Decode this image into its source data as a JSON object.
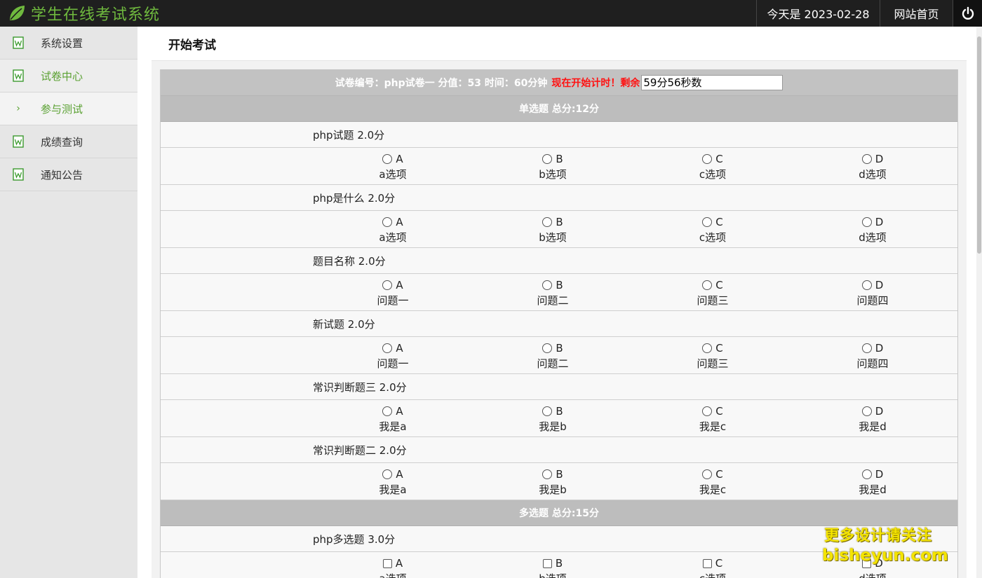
{
  "header": {
    "title": "学生在线考试系统",
    "date_text": "今天是 2023-02-28",
    "home_link": "网站首页",
    "brand_color": "#6fb93e"
  },
  "sidebar": {
    "items": [
      {
        "label": "系统设置"
      },
      {
        "label": "试卷中心"
      },
      {
        "label": "参与测试"
      },
      {
        "label": "成绩查询"
      },
      {
        "label": "通知公告"
      }
    ]
  },
  "main": {
    "page_title": "开始考试",
    "exam_info": {
      "prefix": "试卷编号：php试卷一 分值：53 时间：60分钟",
      "notice": "现在开始计时！剩余",
      "timer_value": "59分56秒数"
    },
    "sections": [
      {
        "header": "单选题 总分:12分",
        "input_type": "radio",
        "questions": [
          {
            "title": "php试题 2.0分",
            "options": [
              {
                "letter": "A",
                "text": "a选项"
              },
              {
                "letter": "B",
                "text": "b选项"
              },
              {
                "letter": "C",
                "text": "c选项"
              },
              {
                "letter": "D",
                "text": "d选项"
              }
            ]
          },
          {
            "title": "php是什么 2.0分",
            "options": [
              {
                "letter": "A",
                "text": "a选项"
              },
              {
                "letter": "B",
                "text": "b选项"
              },
              {
                "letter": "C",
                "text": "c选项"
              },
              {
                "letter": "D",
                "text": "d选项"
              }
            ]
          },
          {
            "title": "题目名称 2.0分",
            "options": [
              {
                "letter": "A",
                "text": "问题一"
              },
              {
                "letter": "B",
                "text": "问题二"
              },
              {
                "letter": "C",
                "text": "问题三"
              },
              {
                "letter": "D",
                "text": "问题四"
              }
            ]
          },
          {
            "title": "新试题 2.0分",
            "options": [
              {
                "letter": "A",
                "text": "问题一"
              },
              {
                "letter": "B",
                "text": "问题二"
              },
              {
                "letter": "C",
                "text": "问题三"
              },
              {
                "letter": "D",
                "text": "问题四"
              }
            ]
          },
          {
            "title": "常识判断题三 2.0分",
            "options": [
              {
                "letter": "A",
                "text": "我是a"
              },
              {
                "letter": "B",
                "text": "我是b"
              },
              {
                "letter": "C",
                "text": "我是c"
              },
              {
                "letter": "D",
                "text": "我是d"
              }
            ]
          },
          {
            "title": "常识判断题二 2.0分",
            "options": [
              {
                "letter": "A",
                "text": "我是a"
              },
              {
                "letter": "B",
                "text": "我是b"
              },
              {
                "letter": "C",
                "text": "我是c"
              },
              {
                "letter": "D",
                "text": "我是d"
              }
            ]
          }
        ]
      },
      {
        "header": "多选题 总分:15分",
        "input_type": "checkbox",
        "questions": [
          {
            "title": "php多选题 3.0分",
            "options": [
              {
                "letter": "A",
                "text": "a选项"
              },
              {
                "letter": "B",
                "text": "b选项"
              },
              {
                "letter": "C",
                "text": "c选项"
              },
              {
                "letter": "D",
                "text": "d选项"
              }
            ]
          }
        ]
      }
    ]
  },
  "watermark": {
    "line1": "更多设计请关注",
    "line2": "bisheyun.com"
  }
}
